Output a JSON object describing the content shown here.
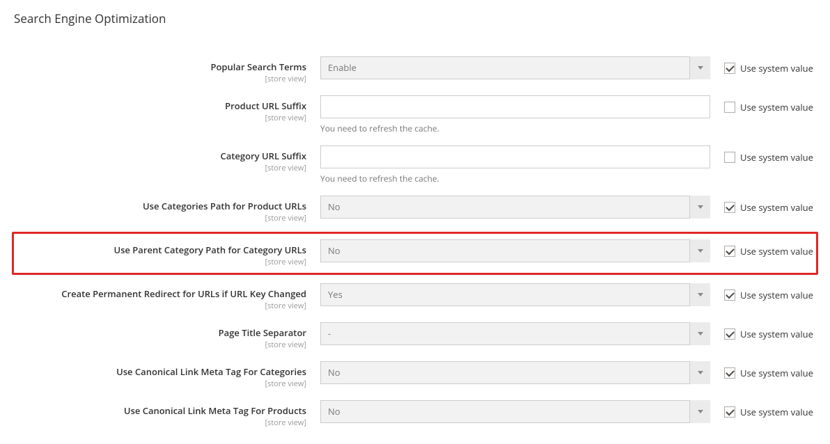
{
  "section": {
    "title": "Search Engine Optimization"
  },
  "common": {
    "scope": "[store view]",
    "use_system": "Use system value",
    "cache_note": "You need to refresh the cache."
  },
  "fields": {
    "popular_terms": {
      "label": "Popular Search Terms",
      "value": "Enable",
      "checked": true
    },
    "product_suffix": {
      "label": "Product URL Suffix",
      "value": "",
      "checked": false
    },
    "category_suffix": {
      "label": "Category URL Suffix",
      "value": "",
      "checked": false
    },
    "cat_path_product": {
      "label": "Use Categories Path for Product URLs",
      "value": "No",
      "checked": true
    },
    "parent_cat_path": {
      "label": "Use Parent Category Path for Category URLs",
      "value": "No",
      "checked": true
    },
    "perm_redirect": {
      "label": "Create Permanent Redirect for URLs if URL Key Changed",
      "value": "Yes",
      "checked": true
    },
    "title_sep": {
      "label": "Page Title Separator",
      "value": "-",
      "checked": true
    },
    "canon_cat": {
      "label": "Use Canonical Link Meta Tag For Categories",
      "value": "No",
      "checked": true
    },
    "canon_prod": {
      "label": "Use Canonical Link Meta Tag For Products",
      "value": "No",
      "checked": true
    }
  }
}
